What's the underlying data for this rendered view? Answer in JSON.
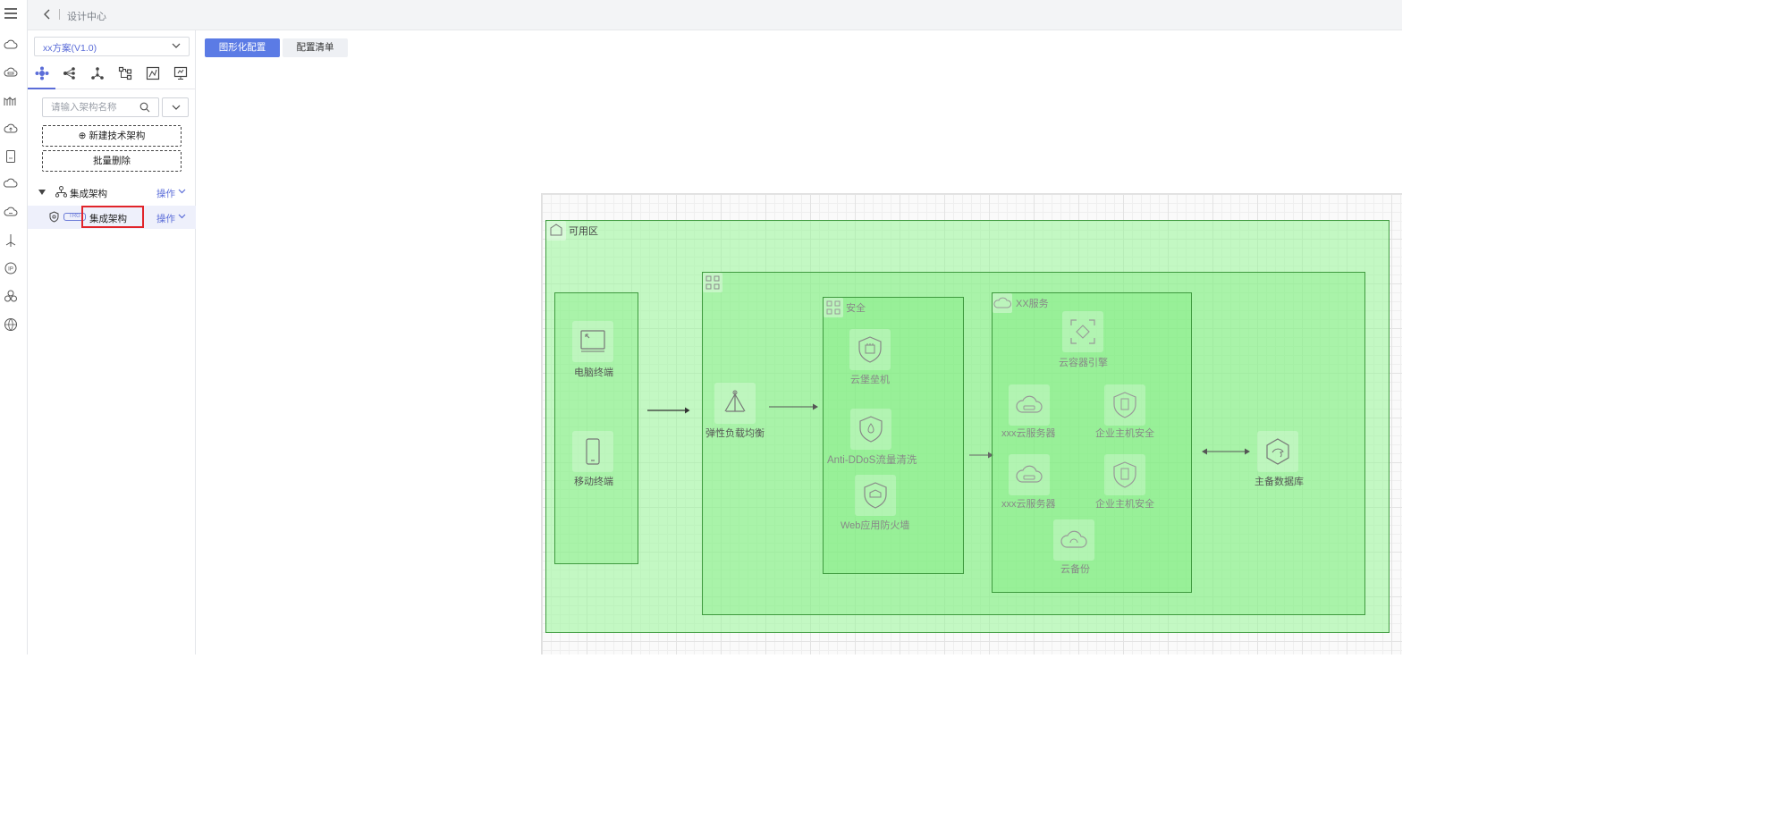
{
  "header": {
    "breadcrumb": "设计中心"
  },
  "rail": {
    "icons": [
      "menu-icon",
      "cloud-icon",
      "cloud-server-icon",
      "bridge-icon",
      "cloud-upload-icon",
      "storage-icon",
      "cloud-icon",
      "cloud-download-icon",
      "network-icon",
      "ip-icon",
      "cluster-icon",
      "globe-icon"
    ]
  },
  "panel": {
    "scheme_select": "xx方案(V1.0)",
    "tabs": [
      "architecture-tab",
      "topology-tab",
      "deployment-tab",
      "flow-tab",
      "chart-tab",
      "monitor-tab"
    ],
    "search_placeholder": "请输入架构名称",
    "new_button": "⊕ 新建技术架构",
    "batch_delete_button": "批量删除",
    "tree": [
      {
        "label": "集成架构",
        "action": "操作"
      },
      {
        "label": "集成架构",
        "action": "操作",
        "badge": "TRG"
      }
    ]
  },
  "view_tabs": {
    "graphical": "图形化配置",
    "list": "配置清单"
  },
  "diagram": {
    "outer_zone": "可用区",
    "security_zone": "安全",
    "service_zone": "XX服务",
    "nodes": {
      "pc": "电脑终端",
      "mobile": "移动终端",
      "elb": "弹性负载均衡",
      "bastion": "云堡垒机",
      "anti_ddos": "Anti-DDoS流量清洗",
      "waf": "Web应用防火墙",
      "container_engine": "云容器引擎",
      "server1": "xxx云服务器",
      "host_sec1": "企业主机安全",
      "server2": "xxx云服务器",
      "host_sec2": "企业主机安全",
      "backup": "云备份",
      "database": "主备数据库"
    }
  }
}
